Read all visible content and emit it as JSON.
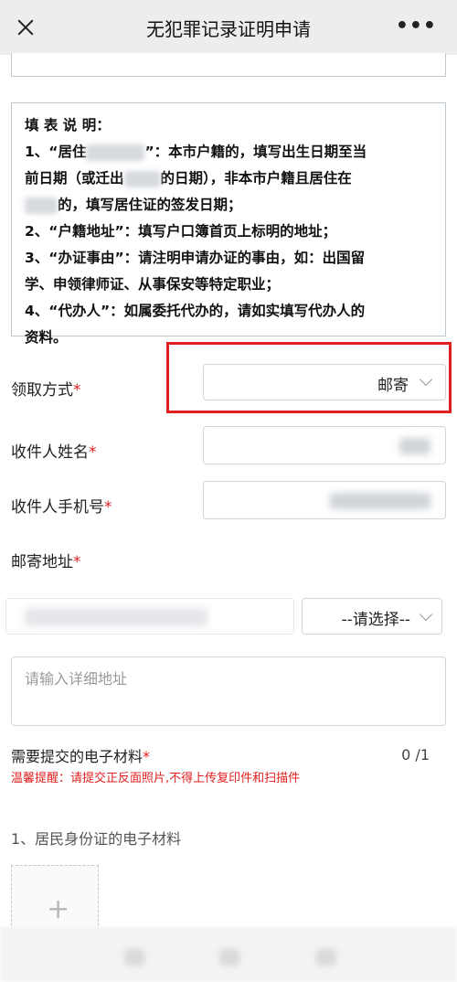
{
  "navbar": {
    "title": "无犯罪记录证明申请",
    "close_icon": "close-icon",
    "more_label": "•••"
  },
  "notice": {
    "heading": "填 表 说 明：",
    "line1_a": "1、“居住",
    "line1_b": "”：本市户籍的，填写出生日期至当",
    "line2_a": "前日期（或迁出",
    "line2_b": "的日期），非本市户籍且居住在",
    "line3_b": "的，填写居住证的签发日期；",
    "line4": "2、“户籍地址”：填写户口簿首页上标明的地址；",
    "line5": "3、“办证事由”：请注明申请办证的事由，如：出国留",
    "line6": "学、申领律师证、从事保安等特定职业；",
    "line7": "4、“代办人”：如属委托代办的，请如实填写代办人的",
    "line8": "资料。"
  },
  "form": {
    "pickup_label": "领取方式",
    "pickup_value": "邮寄",
    "recipient_name_label": "收件人姓名",
    "recipient_phone_label": "收件人手机号",
    "mail_address_label": "邮寄地址",
    "region_select_placeholder": "--请选择--",
    "detail_address_placeholder": "请输入详细地址",
    "required_mark": "*"
  },
  "materials": {
    "label": "需要提交的电子材料",
    "counter": "0 /1",
    "tip": "温馨提醒：请提交正反面照片,不得上传复印件和扫描件",
    "item1_title": "1、居民身份证的电子材料"
  },
  "colors": {
    "required": "#e02020",
    "highlight_border": "#e02020",
    "navbar_bg": "#ededed"
  }
}
